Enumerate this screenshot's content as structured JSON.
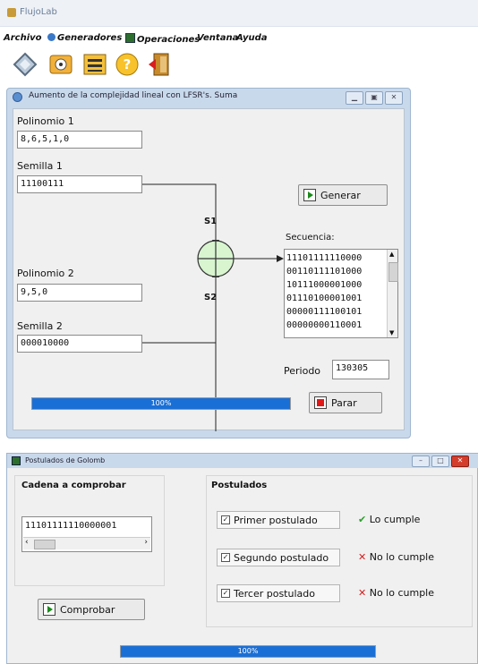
{
  "app": {
    "title": "FlujoLab",
    "menu": [
      "Archivo",
      "Generadores",
      "Operaciones",
      "Ventana",
      "Ayuda"
    ]
  },
  "lfsr_window": {
    "title": "Aumento de la complejidad lineal con LFSR's. Suma",
    "polinomio1_label": "Polinomio 1",
    "polinomio1_value": "8,6,5,1,0",
    "semilla1_label": "Semilla 1",
    "semilla1_value": "11100111",
    "generar_label": "Generar",
    "s1_label": "S1",
    "s2_label": "S2",
    "secuencia_label": "Secuencia:",
    "secuencia_lines": [
      "11101111110000",
      "00110111101000",
      "10111000001000",
      "01110100001001",
      "00000111100101",
      "00000000110001"
    ],
    "polinomio2_label": "Polinomio 2",
    "polinomio2_value": "9,5,0",
    "semilla2_label": "Semilla 2",
    "semilla2_value": "000010000",
    "periodo_label": "Periodo",
    "periodo_value": "130305",
    "progress_text": "100%",
    "progress": 1.0,
    "parar_label": "Parar"
  },
  "golomb_window": {
    "title": "Postulados de Golomb",
    "cadena_label": "Cadena a comprobar",
    "cadena_value": "11101111110000001",
    "comprobar_label": "Comprobar",
    "postulados_label": "Postulados",
    "postulados": [
      {
        "label": "Primer postulado",
        "result": "Lo cumple",
        "ok": true
      },
      {
        "label": "Segundo postulado",
        "result": "No lo cumple",
        "ok": false
      },
      {
        "label": "Tercer postulado",
        "result": "No lo cumple",
        "ok": false
      }
    ],
    "progress_text": "100%",
    "progress": 1.0
  },
  "colors": {
    "accent": "#1a6fd6",
    "ok": "#2e9e2e",
    "fail": "#d42020",
    "xor": "#d8f5d0"
  }
}
